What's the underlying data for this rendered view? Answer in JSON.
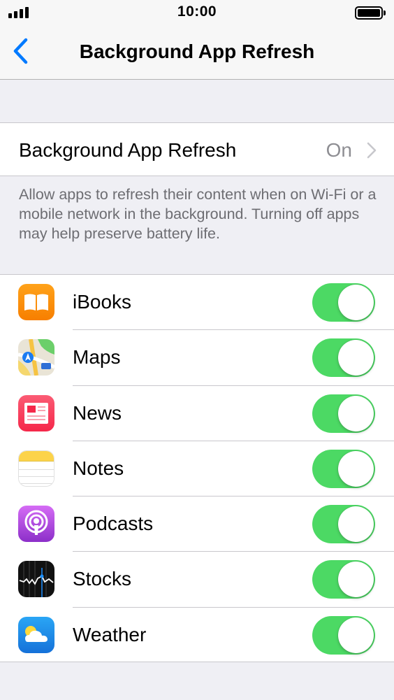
{
  "status_bar": {
    "time": "10:00"
  },
  "nav": {
    "title": "Background App Refresh"
  },
  "main_setting": {
    "label": "Background App Refresh",
    "value": "On"
  },
  "footer_note": "Allow apps to refresh their content when on Wi-Fi or a mobile network in the background. Turning off apps may help preserve battery life.",
  "colors": {
    "accent": "#007aff",
    "toggle_on": "#4cd964"
  },
  "apps": [
    {
      "label": "iBooks",
      "icon": "ibooks-icon",
      "enabled": true
    },
    {
      "label": "Maps",
      "icon": "maps-icon",
      "enabled": true
    },
    {
      "label": "News",
      "icon": "news-icon",
      "enabled": true
    },
    {
      "label": "Notes",
      "icon": "notes-icon",
      "enabled": true
    },
    {
      "label": "Podcasts",
      "icon": "podcasts-icon",
      "enabled": true
    },
    {
      "label": "Stocks",
      "icon": "stocks-icon",
      "enabled": true
    },
    {
      "label": "Weather",
      "icon": "weather-icon",
      "enabled": true
    }
  ]
}
